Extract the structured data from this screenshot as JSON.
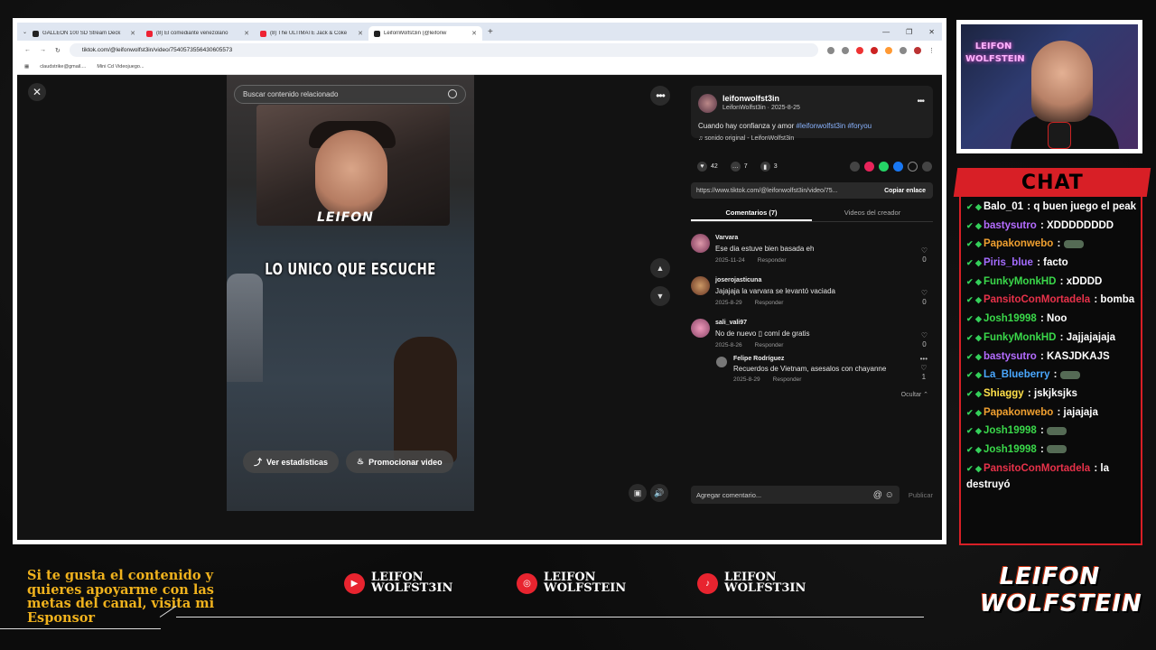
{
  "browser": {
    "tabs": [
      {
        "title": "GALLEON 100 SD Stream Deck",
        "active": false
      },
      {
        "title": "(8) El comediante venezolano",
        "active": false
      },
      {
        "title": "(8) The ULTIMATE Jack & Coke",
        "active": false
      },
      {
        "title": "LeifonWolfst3in (@leifonw",
        "active": true
      }
    ],
    "url": "tiktok.com/@leifonwolfst3in/video/7540573556430605573",
    "bookmarks": [
      "claudstrike@gmail....",
      "Mini Cd Videojuego..."
    ]
  },
  "video": {
    "search_placeholder": "Buscar contenido relacionado",
    "overlay_logo": "LEIFON",
    "caption": "LO UNICO QUE ESCUCHE",
    "btn_stats": "Ver estadísticas",
    "btn_promote": "Promocionar video"
  },
  "post": {
    "username": "leifonwolfst3in",
    "subline": "LeifonWolfst3in · 2025-8-25",
    "description": "Cuando hay confianza y amor ",
    "tags": "#leifonwolfst3in #foryou",
    "sound": "sonido original - LeifonWolfst3in",
    "likes": "42",
    "comments": "7",
    "saves": "3",
    "link": "https://www.tiktok.com/@leifonwolfst3in/video/75...",
    "copy_link": "Copiar enlace",
    "tab_comments": "Comentarios (7)",
    "tab_videos": "Videos del creador",
    "hide": "Ocultar",
    "comment_placeholder": "Agregar comentario...",
    "publish": "Publicar"
  },
  "comments": [
    {
      "user": "Varvara",
      "text": "Ese dia estuve bien basada eh",
      "date": "2025-11-24",
      "reply": "Responder",
      "likes": "0"
    },
    {
      "user": "joserojasticuna",
      "text": "Jajajaja la varvara se levantó vaciada",
      "date": "2025-8-29",
      "reply": "Responder",
      "likes": "0"
    },
    {
      "user": "sali_vali97",
      "text": "No de nuevo ▯ comí de gratis",
      "date": "2025-8-26",
      "reply": "Responder",
      "likes": "0"
    },
    {
      "user": "Felipe Rodríguez",
      "text": "Recuerdos de Vietnam, asesalos con chayanne",
      "date": "2025-8-29",
      "reply": "Responder",
      "likes": "1"
    }
  ],
  "chat": {
    "title": "CHAT",
    "messages": [
      {
        "user": "Balo_01",
        "color": "#ffffff",
        "text": "q buen juego el peak"
      },
      {
        "user": "bastysutro",
        "color": "#b46cff",
        "text": "XDDDDDDDD"
      },
      {
        "user": "Papakonwebo",
        "color": "#f0a030",
        "text": ""
      },
      {
        "user": "Piris_blue",
        "color": "#a46cff",
        "text": "facto"
      },
      {
        "user": "FunkyMonkHD",
        "color": "#3ad84a",
        "text": "xDDDD"
      },
      {
        "user": "PansitoConMortadela",
        "color": "#e8324a",
        "text": "bomba"
      },
      {
        "user": "Josh19998",
        "color": "#3ad84a",
        "text": "Noo"
      },
      {
        "user": "FunkyMonkHD",
        "color": "#3ad84a",
        "text": "Jajjajajaja"
      },
      {
        "user": "bastysutro",
        "color": "#b46cff",
        "text": "KASJDKAJS"
      },
      {
        "user": "La_Blueberry",
        "color": "#4aa8ff",
        "text": ""
      },
      {
        "user": "Shiaggy",
        "color": "#ffe04a",
        "text": "jskjksjks"
      },
      {
        "user": "Papakonwebo",
        "color": "#f0a030",
        "text": "jajajaja"
      },
      {
        "user": "Josh19998",
        "color": "#3ad84a",
        "text": ""
      },
      {
        "user": "Josh19998",
        "color": "#3ad84a",
        "text": ""
      },
      {
        "user": "PansitoConMortadela",
        "color": "#e8324a",
        "text": "la destruyó"
      }
    ]
  },
  "overlay": {
    "sponsor_text": "Si te gusta el contenido y quieres apoyarme con las metas del canal, visita mi Esponsor",
    "youtube": {
      "line1": "LEIFON",
      "line2": "WOLFST3IN"
    },
    "instagram": {
      "line1": "LEIFON",
      "line2": "WOLFSTEIN"
    },
    "tiktok": {
      "line1": "LEIFON",
      "line2": "WOLFST3IN"
    },
    "brand_line1": "LEIFON",
    "brand_line2": "WOLFSTEIN",
    "cam_sign": "LEIFON WOLFSTEIN"
  }
}
